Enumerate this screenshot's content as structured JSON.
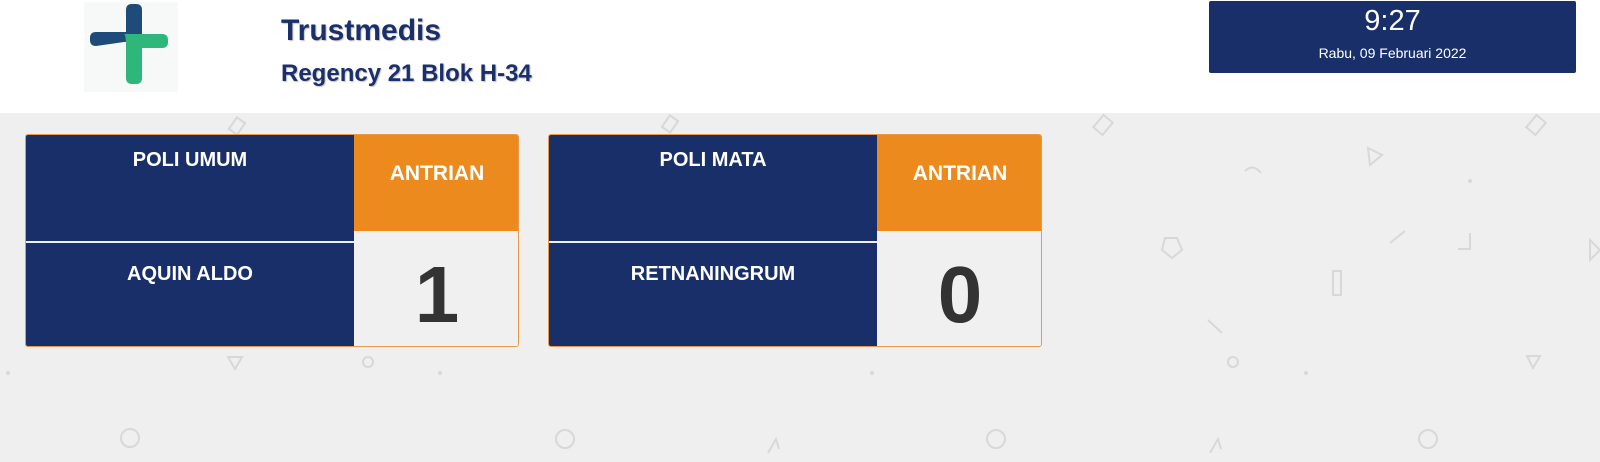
{
  "header": {
    "clinic_name": "Trustmedis",
    "address": "Regency 21 Blok H-34"
  },
  "clock": {
    "time": "9:27",
    "date": "Rabu, 09 Februari 2022"
  },
  "queues": [
    {
      "poli": "POLI UMUM",
      "label": "ANTRIAN",
      "patient": "AQUIN ALDO",
      "number": "1"
    },
    {
      "poli": "POLI MATA",
      "label": "ANTRIAN",
      "patient": "RETNANINGRUM",
      "number": "0"
    }
  ],
  "colors": {
    "navy": "#182f69",
    "orange": "#ec8a1d",
    "logo_blue": "#1e4b7a",
    "logo_green": "#2fb67a"
  }
}
